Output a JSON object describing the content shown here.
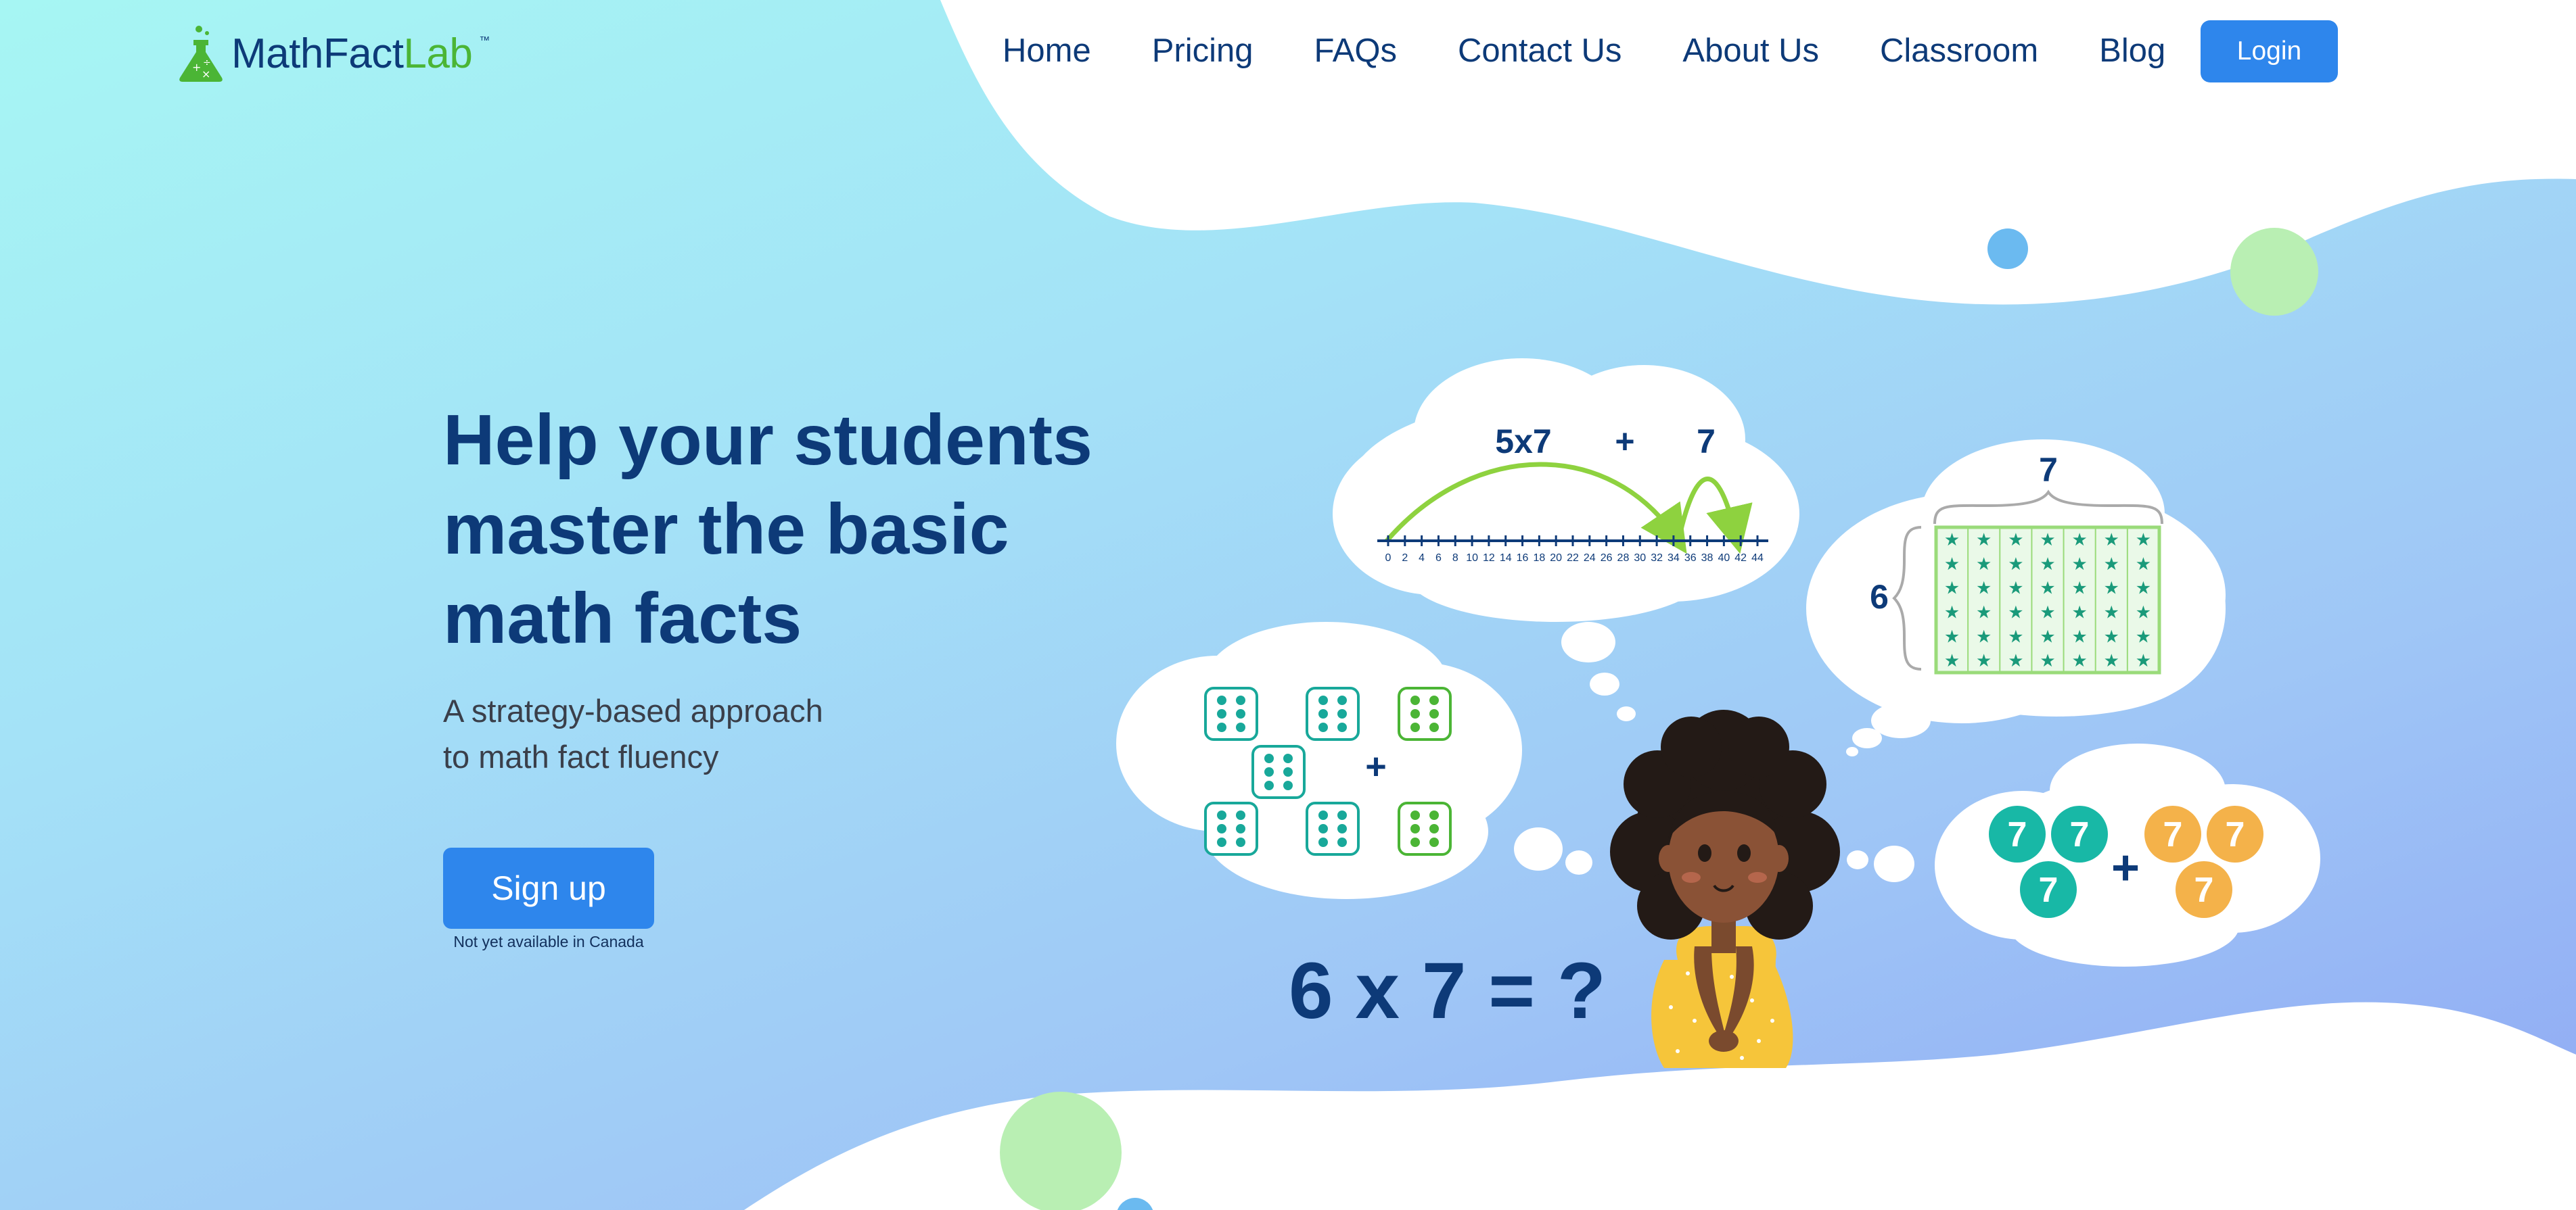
{
  "brand": {
    "name_main": "MathFact",
    "name_accent": "Lab",
    "tm": "™"
  },
  "nav": {
    "items": [
      "Home",
      "Pricing",
      "FAQs",
      "Contact Us",
      "About Us",
      "Classroom",
      "Blog"
    ],
    "login_label": "Login"
  },
  "hero": {
    "title": "Help your students master the basic math facts",
    "subtitle_line1": "A strategy-based approach",
    "subtitle_line2": "to math fact fluency",
    "signup_label": "Sign up",
    "signup_note": "Not yet available in Canada"
  },
  "illustration": {
    "equation": "6 x 7 = ?",
    "numberline_cloud": {
      "label_a": "5x7",
      "plus": "+",
      "label_b": "7",
      "ticks": [
        "0",
        "2",
        "4",
        "6",
        "8",
        "10",
        "12",
        "14",
        "16",
        "18",
        "20",
        "22",
        "24",
        "26",
        "28",
        "30",
        "32",
        "34",
        "36",
        "38",
        "40",
        "42",
        "44"
      ]
    },
    "array_cloud": {
      "top_label": "7",
      "side_label": "6",
      "rows": 6,
      "cols": 7
    },
    "dice_cloud": {
      "plus": "+"
    },
    "counters_cloud": {
      "left": [
        "7",
        "7",
        "7"
      ],
      "right": [
        "7",
        "7",
        "7"
      ],
      "plus": "+"
    }
  },
  "colors": {
    "navy": "#0d3a78",
    "button_blue": "#2e86ec",
    "teal": "#18b8a6",
    "green": "#4bb535",
    "orange": "#f4b24a"
  }
}
